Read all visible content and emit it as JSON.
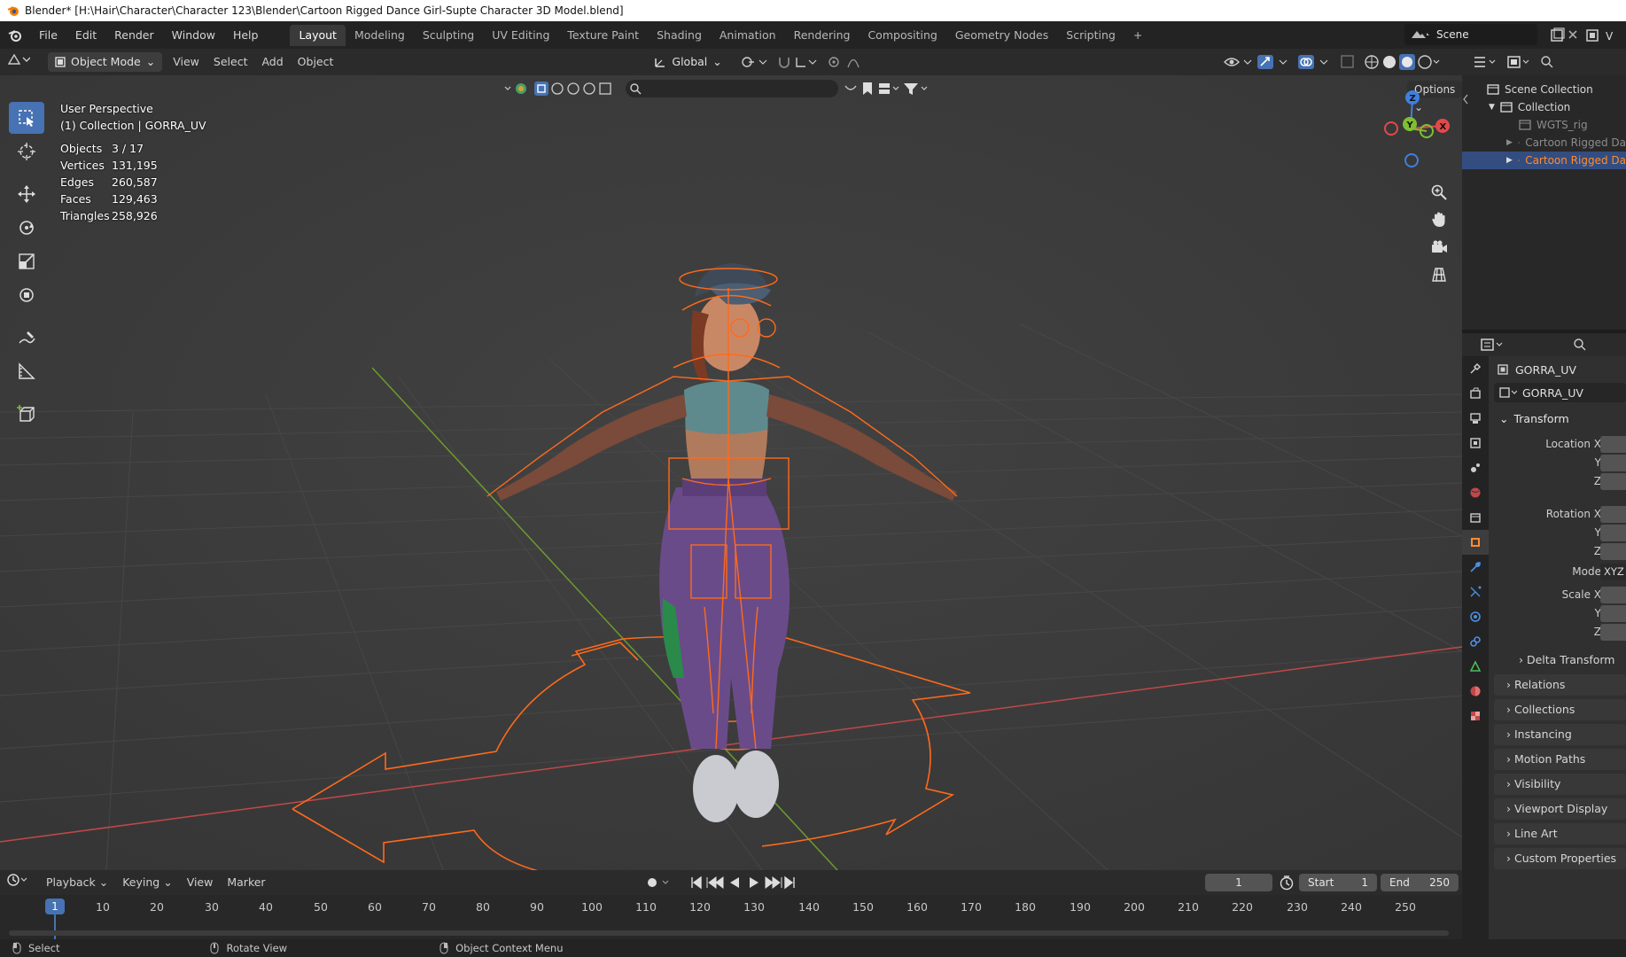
{
  "window_title": "Blender* [H:\\Hair\\Character\\Character 123\\Blender\\Cartoon Rigged Dance Girl-Supte Character 3D Model.blend]",
  "menus": [
    "File",
    "Edit",
    "Render",
    "Window",
    "Help"
  ],
  "workspaces": [
    "Layout",
    "Modeling",
    "Sculpting",
    "UV Editing",
    "Texture Paint",
    "Shading",
    "Animation",
    "Rendering",
    "Compositing",
    "Geometry Nodes",
    "Scripting"
  ],
  "active_workspace": "Layout",
  "scene_name": "Scene",
  "viewport": {
    "mode": "Object Mode",
    "header_menus": [
      "View",
      "Select",
      "Add",
      "Object"
    ],
    "transform_orientation": "Global",
    "options_label": "Options",
    "perspective_label": "User Perspective",
    "collection_label": "(1) Collection | GORRA_UV",
    "stats": [
      {
        "label": "Objects",
        "value": "3 / 17"
      },
      {
        "label": "Vertices",
        "value": "131,195"
      },
      {
        "label": "Edges",
        "value": "260,587"
      },
      {
        "label": "Faces",
        "value": "129,463"
      },
      {
        "label": "Triangles",
        "value": "258,926"
      }
    ],
    "gizmo_axes": {
      "x": "X",
      "y": "Y",
      "z": "Z"
    }
  },
  "timeline": {
    "menus": [
      "Playback",
      "Keying",
      "View",
      "Marker"
    ],
    "current_frame": "1",
    "start_label": "Start",
    "start_value": "1",
    "end_label": "End",
    "end_value": "250",
    "ruler": [
      "10",
      "20",
      "30",
      "40",
      "50",
      "60",
      "70",
      "80",
      "90",
      "100",
      "110",
      "120",
      "130",
      "140",
      "150",
      "160",
      "170",
      "180",
      "190",
      "200",
      "210",
      "220",
      "230",
      "240",
      "250"
    ],
    "playhead_label": "1"
  },
  "statusbar": {
    "select": "Select",
    "rotate": "Rotate View",
    "context": "Object Context Menu"
  },
  "outliner": {
    "rows": [
      {
        "label": "Scene Collection",
        "state": "normal"
      },
      {
        "label": "Collection",
        "state": "normal"
      },
      {
        "label": "WGTS_rig",
        "state": "dim"
      },
      {
        "label": "Cartoon Rigged Da",
        "state": "dim"
      },
      {
        "label": "Cartoon Rigged Da",
        "state": "selected"
      }
    ]
  },
  "properties": {
    "object_name": "GORRA_UV",
    "data_name": "GORRA_UV",
    "transform_label": "Transform",
    "location": [
      "Location X",
      "Y",
      "Z"
    ],
    "rotation": [
      "Rotation X",
      "Y",
      "Z"
    ],
    "mode_label": "Mode",
    "mode_value": "XYZ",
    "scale": [
      "Scale X",
      "Y",
      "Z"
    ],
    "delta_transform": "Delta Transform",
    "panels": [
      "Relations",
      "Collections",
      "Instancing",
      "Motion Paths",
      "Visibility",
      "Viewport Display",
      "Line Art",
      "Custom Properties"
    ]
  },
  "colors": {
    "accent": "#4772b3",
    "selection": "#ff6a1a",
    "x_axis": "#e04a4a",
    "y_axis": "#7fbf32",
    "z_axis": "#3f7fe0"
  }
}
